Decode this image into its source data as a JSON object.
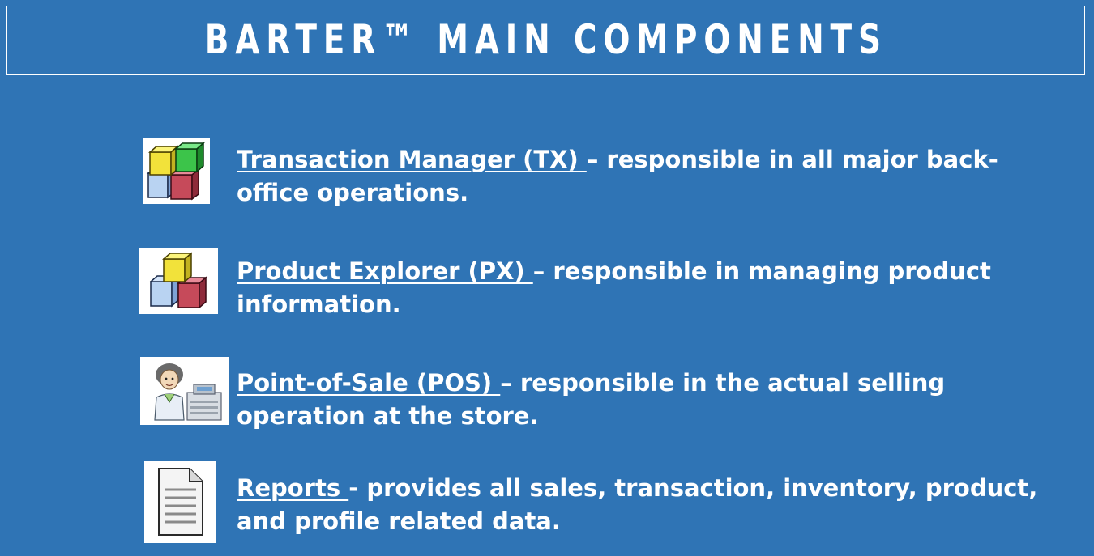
{
  "title": "BARTER™ MAIN COMPONENTS",
  "items": [
    {
      "name": "Transaction Manager (TX) ",
      "description": "– responsible in all major back-office operations.",
      "icon": "colored-cubes-icon"
    },
    {
      "name": "Product Explorer (PX) ",
      "description": "– responsible in managing product information.",
      "icon": "stacked-cubes-icon"
    },
    {
      "name": "Point-of-Sale (POS) ",
      "description": "– responsible in the actual selling operation at the store.",
      "icon": "cashier-icon"
    },
    {
      "name": "Reports ",
      "description": "- provides all sales, transaction, inventory, product, and profile related data.",
      "icon": "document-icon"
    }
  ],
  "colors": {
    "background": "#2f74b5",
    "text": "#ffffff"
  }
}
